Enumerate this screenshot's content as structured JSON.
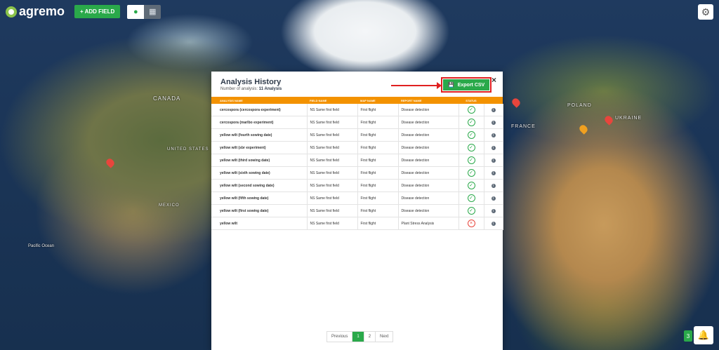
{
  "app": {
    "logo_text": "agremo"
  },
  "toolbar": {
    "add_field_label": "+ ADD FIELD",
    "map_view_icon": "map-pin-icon",
    "grid_view_icon": "grid-icon"
  },
  "map_labels": [
    "CANADA",
    "UNITED STATES",
    "MEXICO",
    "Pacific Ocean",
    "UKRAINE",
    "POLAND",
    "FRANCE"
  ],
  "modal": {
    "title": "Analysis History",
    "subtitle_prefix": "Number of analysis:",
    "subtitle_count": "11 Analysis",
    "export_label": "Export CSV",
    "close_label": "×"
  },
  "table": {
    "headers": [
      "ANALYSIS NAME",
      "FIELD NAME",
      "MAP NAME",
      "REPORT NAME",
      "STATUS",
      ""
    ],
    "rows": [
      {
        "analysis": "cercospora (cercospora experiment)",
        "field": "NS Same first field",
        "map": "First flight",
        "report": "Disease detection",
        "status": "success"
      },
      {
        "analysis": "cercospora (marlbo experiment)",
        "field": "NS Same first field",
        "map": "First flight",
        "report": "Disease detection",
        "status": "success"
      },
      {
        "analysis": "yellow wilt (fourth sowing date)",
        "field": "NS Same first field",
        "map": "First flight",
        "report": "Disease detection",
        "status": "success"
      },
      {
        "analysis": "yellow wilt (sbr experiment)",
        "field": "NS Same first field",
        "map": "First flight",
        "report": "Disease detection",
        "status": "success"
      },
      {
        "analysis": "yellow wilt (third sowing date)",
        "field": "NS Same first field",
        "map": "First flight",
        "report": "Disease detection",
        "status": "success"
      },
      {
        "analysis": "yellow wilt (sixth sowing date)",
        "field": "NS Same first field",
        "map": "First flight",
        "report": "Disease detection",
        "status": "success"
      },
      {
        "analysis": "yellow wilt (second sowing date)",
        "field": "NS Same first field",
        "map": "First flight",
        "report": "Disease detection",
        "status": "success"
      },
      {
        "analysis": "yellow wilt (fifth sowing date)",
        "field": "NS Same first field",
        "map": "First flight",
        "report": "Disease detection",
        "status": "success"
      },
      {
        "analysis": "yellow wilt (first sowing date)",
        "field": "NS Same first field",
        "map": "First flight",
        "report": "Disease detection",
        "status": "success"
      },
      {
        "analysis": "yellow wilt",
        "field": "NS Same first field",
        "map": "First flight",
        "report": "Plant Stress Analysis",
        "status": "failed"
      }
    ]
  },
  "pagination": {
    "previous": "Previous",
    "pages": [
      "1",
      "2"
    ],
    "active": "1",
    "next": "Next"
  },
  "notifications": {
    "count": "3"
  },
  "colors": {
    "accent_green": "#2aa94a",
    "header_orange": "#f39200",
    "alert_red": "#e02020"
  }
}
